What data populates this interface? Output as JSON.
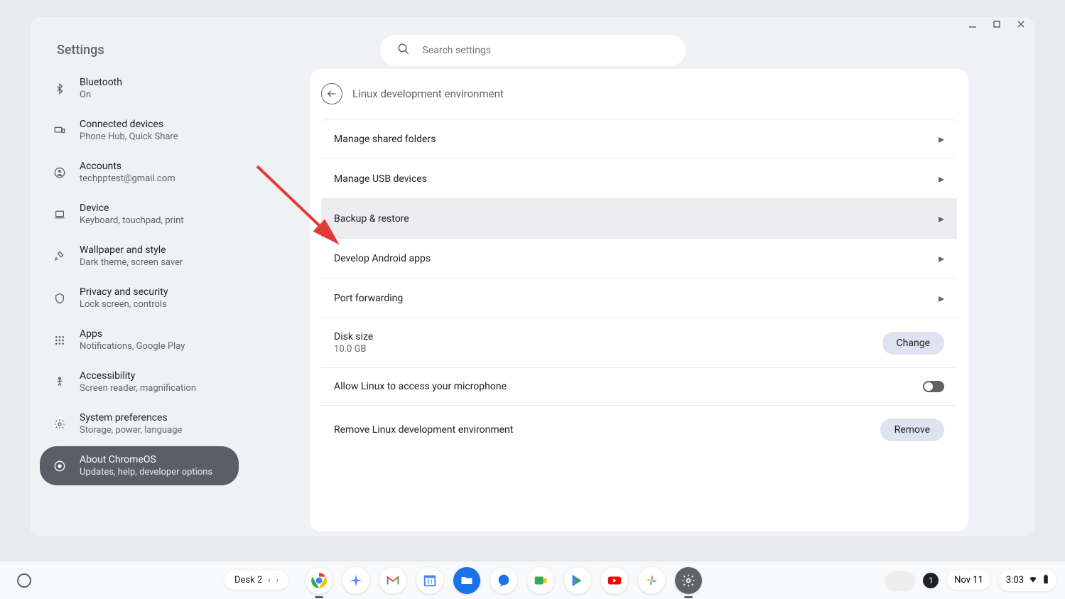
{
  "window": {
    "title": "Settings",
    "search_placeholder": "Search settings"
  },
  "sidebar": {
    "items": [
      {
        "label": "Bluetooth",
        "sublabel": "On"
      },
      {
        "label": "Connected devices",
        "sublabel": "Phone Hub, Quick Share"
      },
      {
        "label": "Accounts",
        "sublabel": "techpptest@gmail.com"
      },
      {
        "label": "Device",
        "sublabel": "Keyboard, touchpad, print"
      },
      {
        "label": "Wallpaper and style",
        "sublabel": "Dark theme, screen saver"
      },
      {
        "label": "Privacy and security",
        "sublabel": "Lock screen, controls"
      },
      {
        "label": "Apps",
        "sublabel": "Notifications, Google Play"
      },
      {
        "label": "Accessibility",
        "sublabel": "Screen reader, magnification"
      },
      {
        "label": "System preferences",
        "sublabel": "Storage, power, language"
      },
      {
        "label": "About ChromeOS",
        "sublabel": "Updates, help, developer options"
      }
    ]
  },
  "panel": {
    "title": "Linux development environment",
    "items": {
      "shared_folders": "Manage shared folders",
      "usb": "Manage USB devices",
      "backup": "Backup & restore",
      "android": "Develop Android apps",
      "port": "Port forwarding",
      "disk_label": "Disk size",
      "disk_value": "10.0 GB",
      "disk_button": "Change",
      "mic": "Allow Linux to access your microphone",
      "remove_label": "Remove Linux development environment",
      "remove_button": "Remove"
    }
  },
  "shelf": {
    "desk_label": "Desk 2",
    "notification_count": "1",
    "date": "Nov 11",
    "time": "3:03"
  }
}
